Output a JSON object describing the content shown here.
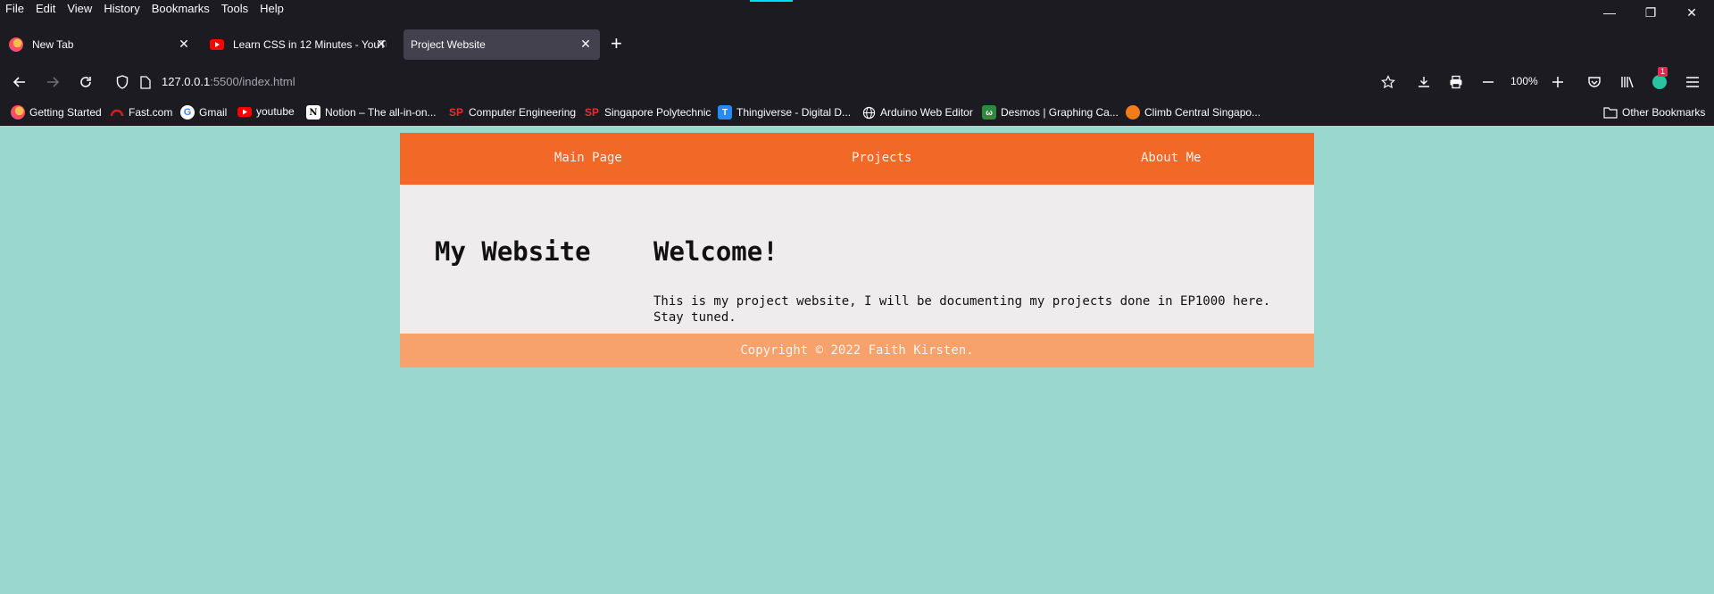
{
  "menubar": {
    "items": [
      "File",
      "Edit",
      "View",
      "History",
      "Bookmarks",
      "Tools",
      "Help"
    ]
  },
  "window_controls": {
    "minimize": "—",
    "restore": "❐",
    "close": "✕"
  },
  "tabs": [
    {
      "title": "New Tab",
      "close": "✕"
    },
    {
      "title": "Learn CSS in 12 Minutes - YouTube",
      "close": "✕"
    },
    {
      "title": "Project Website",
      "close": "✕",
      "active": true
    }
  ],
  "new_tab_glyph": "+",
  "url": {
    "host": "127.0.0.1",
    "path": ":5500/index.html"
  },
  "zoom": "100%",
  "extension_badge": "1",
  "bookmarks": [
    {
      "label": "Getting Started",
      "icon": "firefox-icon"
    },
    {
      "label": "Fast.com",
      "icon": "gauge-icon"
    },
    {
      "label": "Gmail",
      "icon": "google-icon"
    },
    {
      "label": "youtube",
      "icon": "youtube-icon"
    },
    {
      "label": "Notion – The all-in-on...",
      "icon": "notion-icon"
    },
    {
      "label": "Computer Engineering",
      "icon": "sp-icon"
    },
    {
      "label": "Singapore Polytechnic",
      "icon": "sp-icon"
    },
    {
      "label": "Thingiverse - Digital D...",
      "icon": "thingiverse-icon"
    },
    {
      "label": "Arduino Web Editor",
      "icon": "globe-icon"
    },
    {
      "label": "Desmos | Graphing Ca...",
      "icon": "desmos-icon"
    },
    {
      "label": "Climb Central Singapo...",
      "icon": "climb-icon"
    },
    {
      "label": "Other Bookmarks",
      "icon": "folder-icon"
    }
  ],
  "colors": {
    "page_bg": "#9ad7cf",
    "nav_bg": "#f26827",
    "main_bg": "#eeecec",
    "footer_bg": "#f7a26c",
    "chrome_bg": "#1c1b22"
  },
  "site": {
    "nav": [
      "Main Page",
      "Projects",
      "About Me"
    ],
    "title": "My Website",
    "welcome_heading": "Welcome!",
    "welcome_text": "This is my project website, I will be documenting my projects done in EP1000 here. Stay tuned.",
    "footer": "Copyright © 2022 Faith Kirsten."
  }
}
